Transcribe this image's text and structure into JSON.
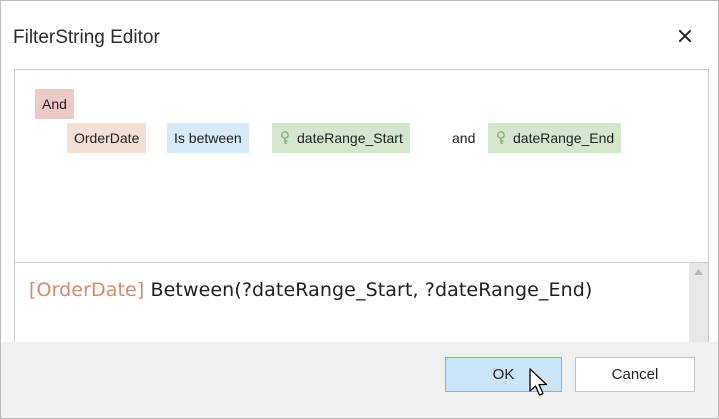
{
  "dialog": {
    "title": "FilterString Editor",
    "close_icon": "close-icon"
  },
  "filter_tree": {
    "group_operator": "And",
    "condition": {
      "field": "OrderDate",
      "operator": "Is between",
      "value1_icon": "parameter-icon",
      "value1": "dateRange_Start",
      "conjunction": "and",
      "value2_icon": "parameter-icon",
      "value2": "dateRange_End"
    }
  },
  "expression": {
    "field_ref": "[OrderDate]",
    "rest": " Between(?dateRange_Start, ?dateRange_End)"
  },
  "buttons": {
    "ok_label": "OK",
    "cancel_label": "Cancel"
  },
  "colors": {
    "group_chip": "#ecc8c6",
    "field_chip": "#f4dfd7",
    "operator_chip": "#d8e9f6",
    "parameter_chip": "#d4e6cd",
    "field_ref_text": "#d8896b",
    "ok_button": "#cce4f7"
  }
}
